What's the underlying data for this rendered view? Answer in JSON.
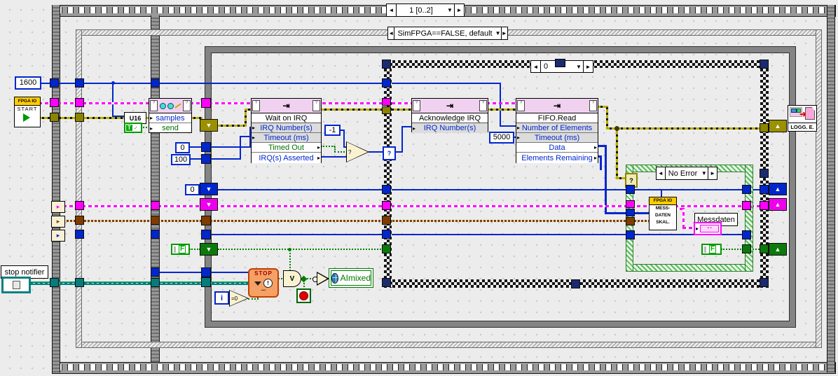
{
  "structures": {
    "outer_sequence": {
      "selector_label": "1 [0..2]"
    },
    "sim_case": {
      "selector_label": "SimFPGA==FALSE, default"
    },
    "irq_case": {
      "selector_label": "0"
    },
    "error_case": {
      "selector_label": "No Error"
    }
  },
  "nodes": {
    "property_node": {
      "row_samples": "samples",
      "row_send": "send"
    },
    "wait_on_irq": {
      "title": "Wait on IRQ",
      "row_irq": "IRQ Number(s)",
      "row_timeout": "Timeout (ms)",
      "row_timed_out": "Timed Out",
      "row_asserted": "IRQ(s) Asserted"
    },
    "acknowledge_irq": {
      "title": "Acknowledge IRQ",
      "row_irq": "IRQ Number(s)"
    },
    "fifo_read": {
      "title": "FIFO.Read",
      "row_elements": "Number of Elements",
      "row_timeout": "Timeout (ms)",
      "row_data": "Data",
      "row_remaining": "Elements Remaining"
    }
  },
  "terminals": {
    "fpga_start": {
      "header": "FPGA IO",
      "label": "START"
    },
    "mess_daten": {
      "header": "FPGA IO",
      "line1": "MESS-",
      "line2": "DATEN",
      "line3": "SKAL."
    },
    "logger": {
      "label": "LOGG. E."
    },
    "stop_notifier": {
      "label": "stop notifier"
    },
    "aimixed": {
      "label": "AImixed"
    },
    "messdaten": {
      "label": "Messdaten"
    },
    "stop_wait": {
      "label": "STOP"
    }
  },
  "constants": {
    "samples": "1600",
    "irq_number": "0",
    "timeout_ms": "100",
    "minus_one": "-1",
    "fifo_timeout": "5000",
    "loop_init": "0",
    "u16": "U16",
    "bool_true": "T",
    "bool_false_outer": "F",
    "bool_false_inner": "F",
    "iteration": "i",
    "equal_zero": "=0"
  },
  "icons": {
    "left_arrow": "◄",
    "right_arrow": "►",
    "dropdown": "▼",
    "row_arrow": "▸",
    "check": "✓",
    "question": "?",
    "or_glyph": "V",
    "excl": "!"
  },
  "colors": {
    "wire_scalar_blue": "#0026cc",
    "wire_fpga_pink": "#ff00ff",
    "wire_error_olive": "#b8ac00",
    "wire_notifier_teal": "#067c7c",
    "wire_bool_green": "#008000",
    "wire_data_brown": "#7b3f00",
    "node_header": "#f0d2f0",
    "fpga_gold": "#ffcc00",
    "case_green": "#5cb85c"
  }
}
